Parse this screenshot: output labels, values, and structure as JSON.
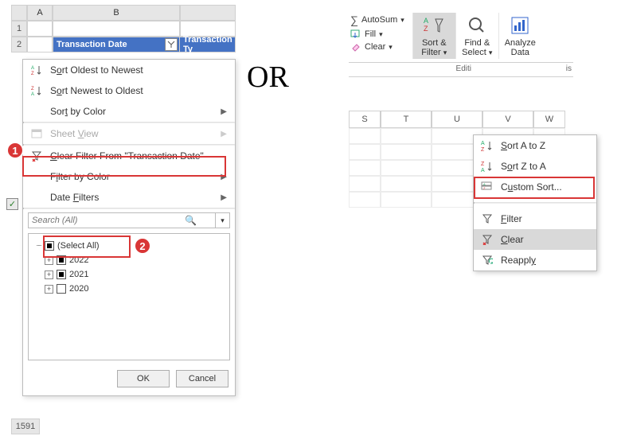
{
  "or_text": "OR",
  "left": {
    "headers": {
      "colA": "A",
      "colB": "B"
    },
    "rows": [
      "1",
      "2"
    ],
    "bottom_row": "1591",
    "header_cell_B": "Transaction Date",
    "header_cell_C": "Transaction Ty",
    "menu": {
      "sort_oldest_html": "S<span class='u'>o</span>rt Oldest to Newest",
      "sort_newest_html": "S<span class='u'>o</span>rt Newest to Oldest",
      "sort_by_color_html": "Sor<span class='u'>t</span> by Color",
      "sheet_view_html": "Sheet <span class='u'>V</span>iew",
      "clear_filter_html": "<span class='u'>C</span>lear Filter From \"Transaction Date\"",
      "filter_by_color_html": "F<span class='u'>i</span>lter by Color",
      "date_filters_html": "Date <span class='u'>F</span>ilters",
      "search_placeholder": "Search (All)",
      "select_all": "(Select All)",
      "years": [
        "2022",
        "2021",
        "2020"
      ],
      "ok": "OK",
      "cancel": "Cancel"
    },
    "badges": {
      "one": "1",
      "two": "2"
    }
  },
  "right": {
    "ribbon": {
      "autosum": "AutoSum",
      "fill": "Fill",
      "clear": "Clear",
      "sort_filter": "Sort & Filter",
      "find_select": "Find & Select",
      "analyze_data": "Analyze Data",
      "group_edit_label": "Editi",
      "group_analysis_label": "is"
    },
    "cols": [
      "S",
      "T",
      "U",
      "V",
      "W"
    ],
    "dropdown": {
      "sort_az_html": "<span class='u'>S</span>ort A to Z",
      "sort_za_html": "S<span class='u'>o</span>rt Z to A",
      "custom_sort_html": "C<span class='u'>u</span>stom Sort...",
      "filter_html": "<span class='u'>F</span>ilter",
      "clear_html": "<span class='u'>C</span>lear",
      "reapply_html": "Reappl<span class='u'>y</span>"
    }
  }
}
